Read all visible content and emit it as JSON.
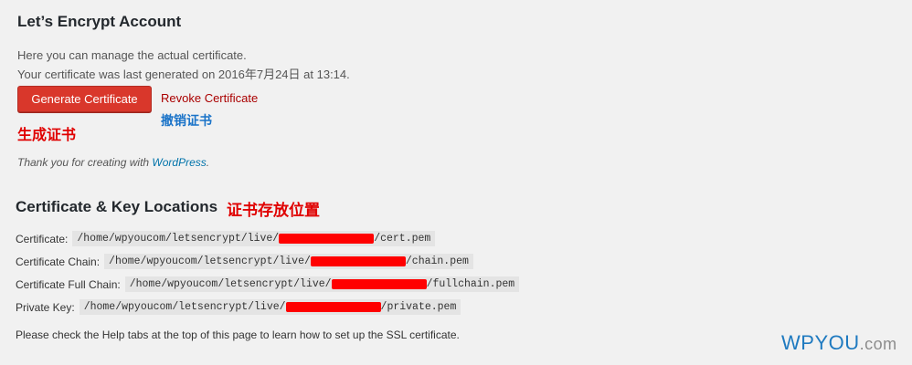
{
  "account": {
    "title": "Let’s Encrypt Account",
    "desc_line1": "Here you can manage the actual certificate.",
    "desc_line2": "Your certificate was last generated on 2016年7月24日 at 13:14.",
    "generate_label": "Generate Certificate",
    "revoke_label": "Revoke Certificate",
    "anno_generate": "生成证书",
    "anno_revoke": "撤销证书"
  },
  "footer_credit": {
    "prefix": "Thank you for creating with ",
    "link": "WordPress",
    "suffix": "."
  },
  "locations": {
    "title": "Certificate & Key Locations",
    "anno_title": "证书存放位置",
    "items": [
      {
        "label": "Certificate:",
        "path_prefix": "/home/wpyoucom/letsencrypt/live/",
        "file": "/cert.pem"
      },
      {
        "label": "Certificate Chain:",
        "path_prefix": "/home/wpyoucom/letsencrypt/live/",
        "file": "/chain.pem"
      },
      {
        "label": "Certificate Full Chain:",
        "path_prefix": "/home/wpyoucom/letsencrypt/live/",
        "file": "/fullchain.pem"
      },
      {
        "label": "Private Key:",
        "path_prefix": "/home/wpyoucom/letsencrypt/live/",
        "file": "/private.pem"
      }
    ],
    "help_note": "Please check the Help tabs at the top of this page to learn how to set up the SSL certificate."
  },
  "watermark": {
    "part1": "WPYOU",
    "part2": ".com"
  },
  "colors": {
    "generate_button": "#d9372b",
    "revoke_link": "#aa0000",
    "annotation_red": "#e00000",
    "annotation_blue": "#1a73c8",
    "redaction": "#ff0000"
  }
}
